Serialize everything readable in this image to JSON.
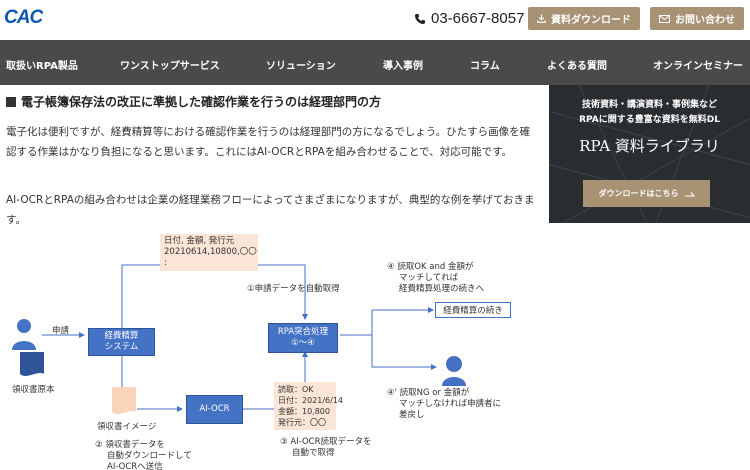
{
  "header": {
    "logo_text": "CAC",
    "phone_icon": "phone-icon",
    "phone": "03-6667-8057",
    "download_label": "資料ダウンロード",
    "download_icon": "download-icon",
    "contact_label": "お問い合わせ",
    "contact_icon": "mail-icon"
  },
  "nav": {
    "items": [
      "取扱いRPA製品",
      "ワンストップサービス",
      "ソリューション",
      "導入事例",
      "コラム",
      "よくある質問",
      "オンラインセミナー"
    ]
  },
  "article": {
    "heading": "電子帳簿保存法の改正に準拠した確認作業を行うのは経理部門の方",
    "para1": "電子化は便利ですが、経費精算等における確認作業を行うのは経理部門の方になるでしょう。ひたすら画像を確認する作業はかなり負担になると思います。これにはAI-OCRとRPAを組み合わせることで、対応可能です。",
    "para2": "AI-OCRとRPAの組み合わせは企業の経理業務フローによってさまざまになりますが、典型的な例を挙げておきます。"
  },
  "diagram": {
    "data_top": [
      "日付, 金額, 発行元",
      "20210614,10800,〇〇",
      ":"
    ],
    "step1": "①申請データを自動取得",
    "applicant_label": "申請",
    "receipt_label": "領収書原本",
    "expense_system": [
      "経費精算",
      "システム"
    ],
    "rpa_box": [
      "RPA突合処理",
      "①〜④"
    ],
    "step4": [
      "④ 読取OK and 金額が",
      "マッチしてれば",
      "経費精算処理の続きへ"
    ],
    "continue_box": "経費精算の続き",
    "step4b": [
      "④' 読取NG or 金額が",
      "マッチしなければ申請者に",
      "差戻し"
    ],
    "image_label": "領収書イメージ",
    "aiocr_box": "AI-OCR",
    "ocr_result": [
      "読取：OK",
      "日付：2021/6/14",
      "金額：10,800",
      "発行元：〇〇"
    ],
    "step2": [
      "② 領収書データを",
      "自動ダウンロードして",
      "AI-OCRへ送信"
    ],
    "step3": [
      "③ AI-OCR読取データを",
      "自動で取得"
    ]
  },
  "ad": {
    "line1": "技術資料・講演資料・事例集など",
    "line2": "RPAに関する豊富な資料を無料DL",
    "title": "RPA 資料ライブラリ",
    "button": "ダウンロードはこちら",
    "button_icon": "arrow-right-icon"
  },
  "colors": {
    "brand_blue": "#0a58b3",
    "gold": "#a89274",
    "nav_bg": "#4a4a4a",
    "box_blue": "#4472c4",
    "peach": "#fbe5d6"
  }
}
